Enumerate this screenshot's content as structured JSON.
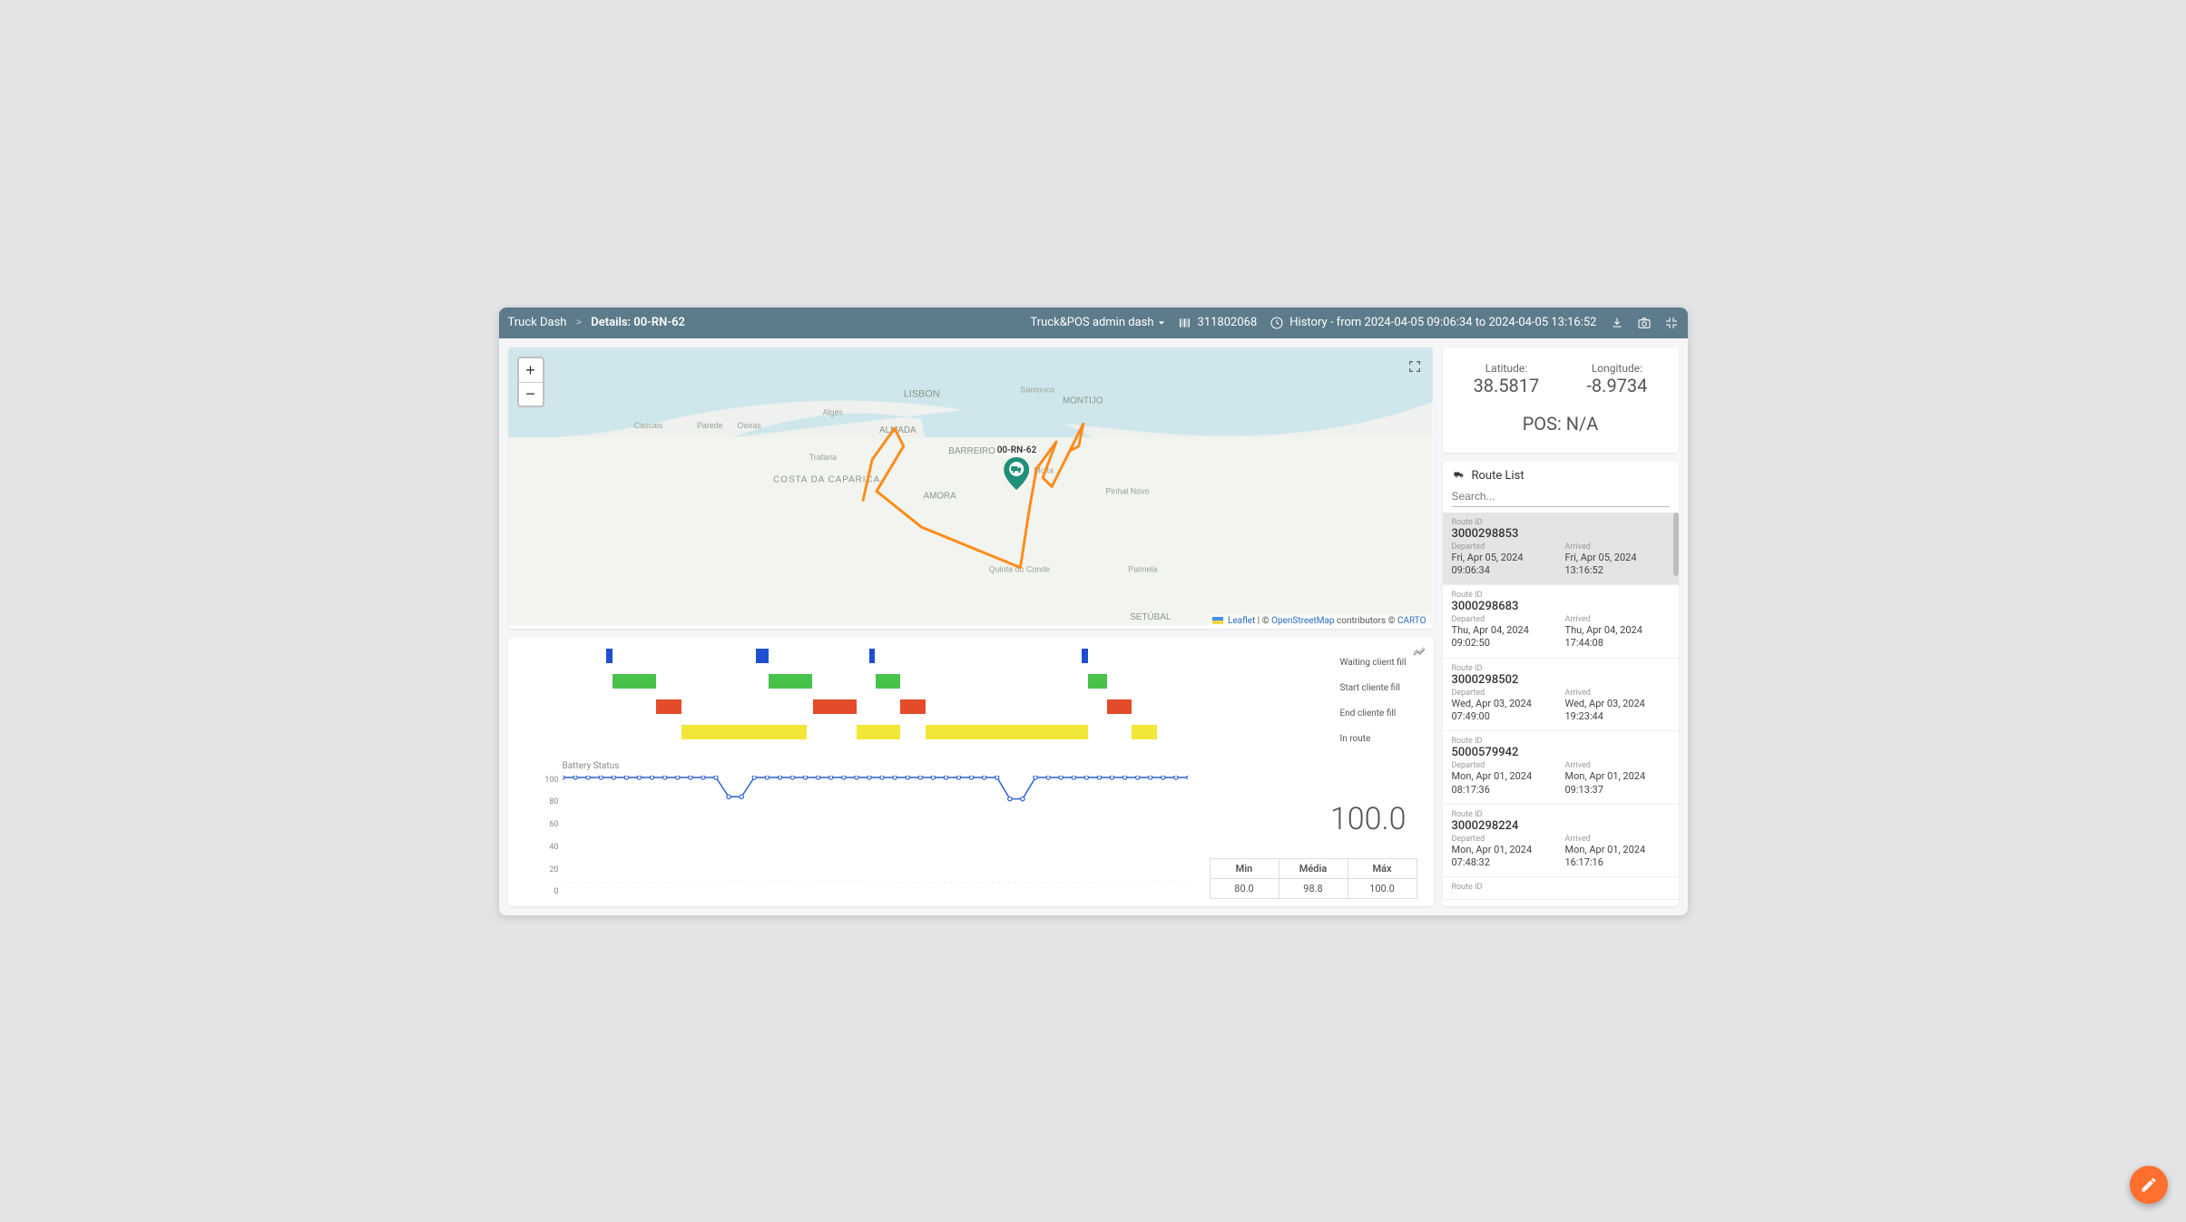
{
  "header": {
    "breadcrumb_root": "Truck Dash",
    "breadcrumb_sep": ">",
    "breadcrumb_current": "Details: 00-RN-62",
    "dashboard_switcher": "Truck&POS admin dash",
    "device_id": "311802068",
    "history_label": "History - from 2024-04-05 09:06:34 to 2024-04-05 13:16:52"
  },
  "map": {
    "truck_label": "00-RN-62",
    "attribution": {
      "leaflet": "Leaflet",
      "mid": " | © ",
      "osm": "OpenStreetMap",
      "tail": " contributors © ",
      "carto": "CARTO"
    },
    "places": [
      "Cascais",
      "Parede",
      "Oeiras",
      "Algés",
      "LISBON",
      "Samouco",
      "MONTIJO",
      "Trafaria",
      "ALMADA",
      "COSTA DA CAPARICA",
      "BARREIRO",
      "Moita",
      "AMORA",
      "Pinhal Novo",
      "Quinta do Conde",
      "Palmela",
      "SETÚBAL"
    ]
  },
  "coords": {
    "lat_label": "Latitude:",
    "lat_value": "38.5817",
    "lon_label": "Longitude:",
    "lon_value": "-8.9734",
    "pos_label": "POS: N/A"
  },
  "route_panel": {
    "title": "Route List",
    "search_placeholder": "Search...",
    "labels": {
      "route_id": "Route ID",
      "departed": "Departed",
      "arrived": "Arrived"
    },
    "items": [
      {
        "id": "3000298853",
        "departed": "Fri, Apr 05, 2024 09:06:34",
        "arrived": "Fri, Apr 05, 2024 13:16:52",
        "selected": true
      },
      {
        "id": "3000298683",
        "departed": "Thu, Apr 04, 2024 09:02:50",
        "arrived": "Thu, Apr 04, 2024 17:44:08",
        "selected": false
      },
      {
        "id": "3000298502",
        "departed": "Wed, Apr 03, 2024 07:49:00",
        "arrived": "Wed, Apr 03, 2024 19:23:44",
        "selected": false
      },
      {
        "id": "5000579942",
        "departed": "Mon, Apr 01, 2024 08:17:36",
        "arrived": "Mon, Apr 01, 2024 09:13:37",
        "selected": false
      },
      {
        "id": "3000298224",
        "departed": "Mon, Apr 01, 2024 07:48:32",
        "arrived": "Mon, Apr 01, 2024 16:17:16",
        "selected": false
      }
    ]
  },
  "chart_data": {
    "type": "gantt+line",
    "gantt": {
      "legend": [
        "Waiting client fill",
        "Start cliente fill",
        "End cliente fill",
        "In route"
      ],
      "colors": [
        "#1f4fd1",
        "#48c24a",
        "#e34b2a",
        "#f2e637"
      ],
      "rows": [
        {
          "bars": [
            {
              "start": 7,
              "end": 8
            },
            {
              "start": 31,
              "end": 33
            },
            {
              "start": 49,
              "end": 50
            },
            {
              "start": 83,
              "end": 84
            }
          ]
        },
        {
          "bars": [
            {
              "start": 8,
              "end": 15
            },
            {
              "start": 33,
              "end": 40
            },
            {
              "start": 50,
              "end": 54
            },
            {
              "start": 84,
              "end": 87
            }
          ]
        },
        {
          "bars": [
            {
              "start": 15,
              "end": 19
            },
            {
              "start": 40,
              "end": 47
            },
            {
              "start": 54,
              "end": 58
            },
            {
              "start": 87,
              "end": 91
            }
          ]
        },
        {
          "bars": [
            {
              "start": 19,
              "end": 39
            },
            {
              "start": 47,
              "end": 54
            },
            {
              "start": 58,
              "end": 84
            },
            {
              "start": 91,
              "end": 95
            }
          ]
        }
      ]
    },
    "battery": {
      "title": "Battery Status",
      "ylim": [
        0,
        100
      ],
      "yticks": [
        100,
        80,
        60,
        40,
        20,
        0
      ],
      "values": [
        100,
        100,
        100,
        100,
        100,
        100,
        100,
        100,
        100,
        100,
        100,
        100,
        100,
        82,
        82,
        100,
        100,
        100,
        100,
        100,
        100,
        100,
        100,
        100,
        100,
        100,
        100,
        100,
        100,
        100,
        100,
        100,
        100,
        100,
        100,
        80,
        80,
        100,
        100,
        100,
        100,
        100,
        100,
        100,
        100,
        100,
        100,
        100,
        100,
        100
      ],
      "big_value": "100.0",
      "stats": {
        "min_label": "Min",
        "min": "80.0",
        "avg_label": "Média",
        "avg": "98.8",
        "max_label": "Máx",
        "max": "100.0"
      }
    }
  }
}
